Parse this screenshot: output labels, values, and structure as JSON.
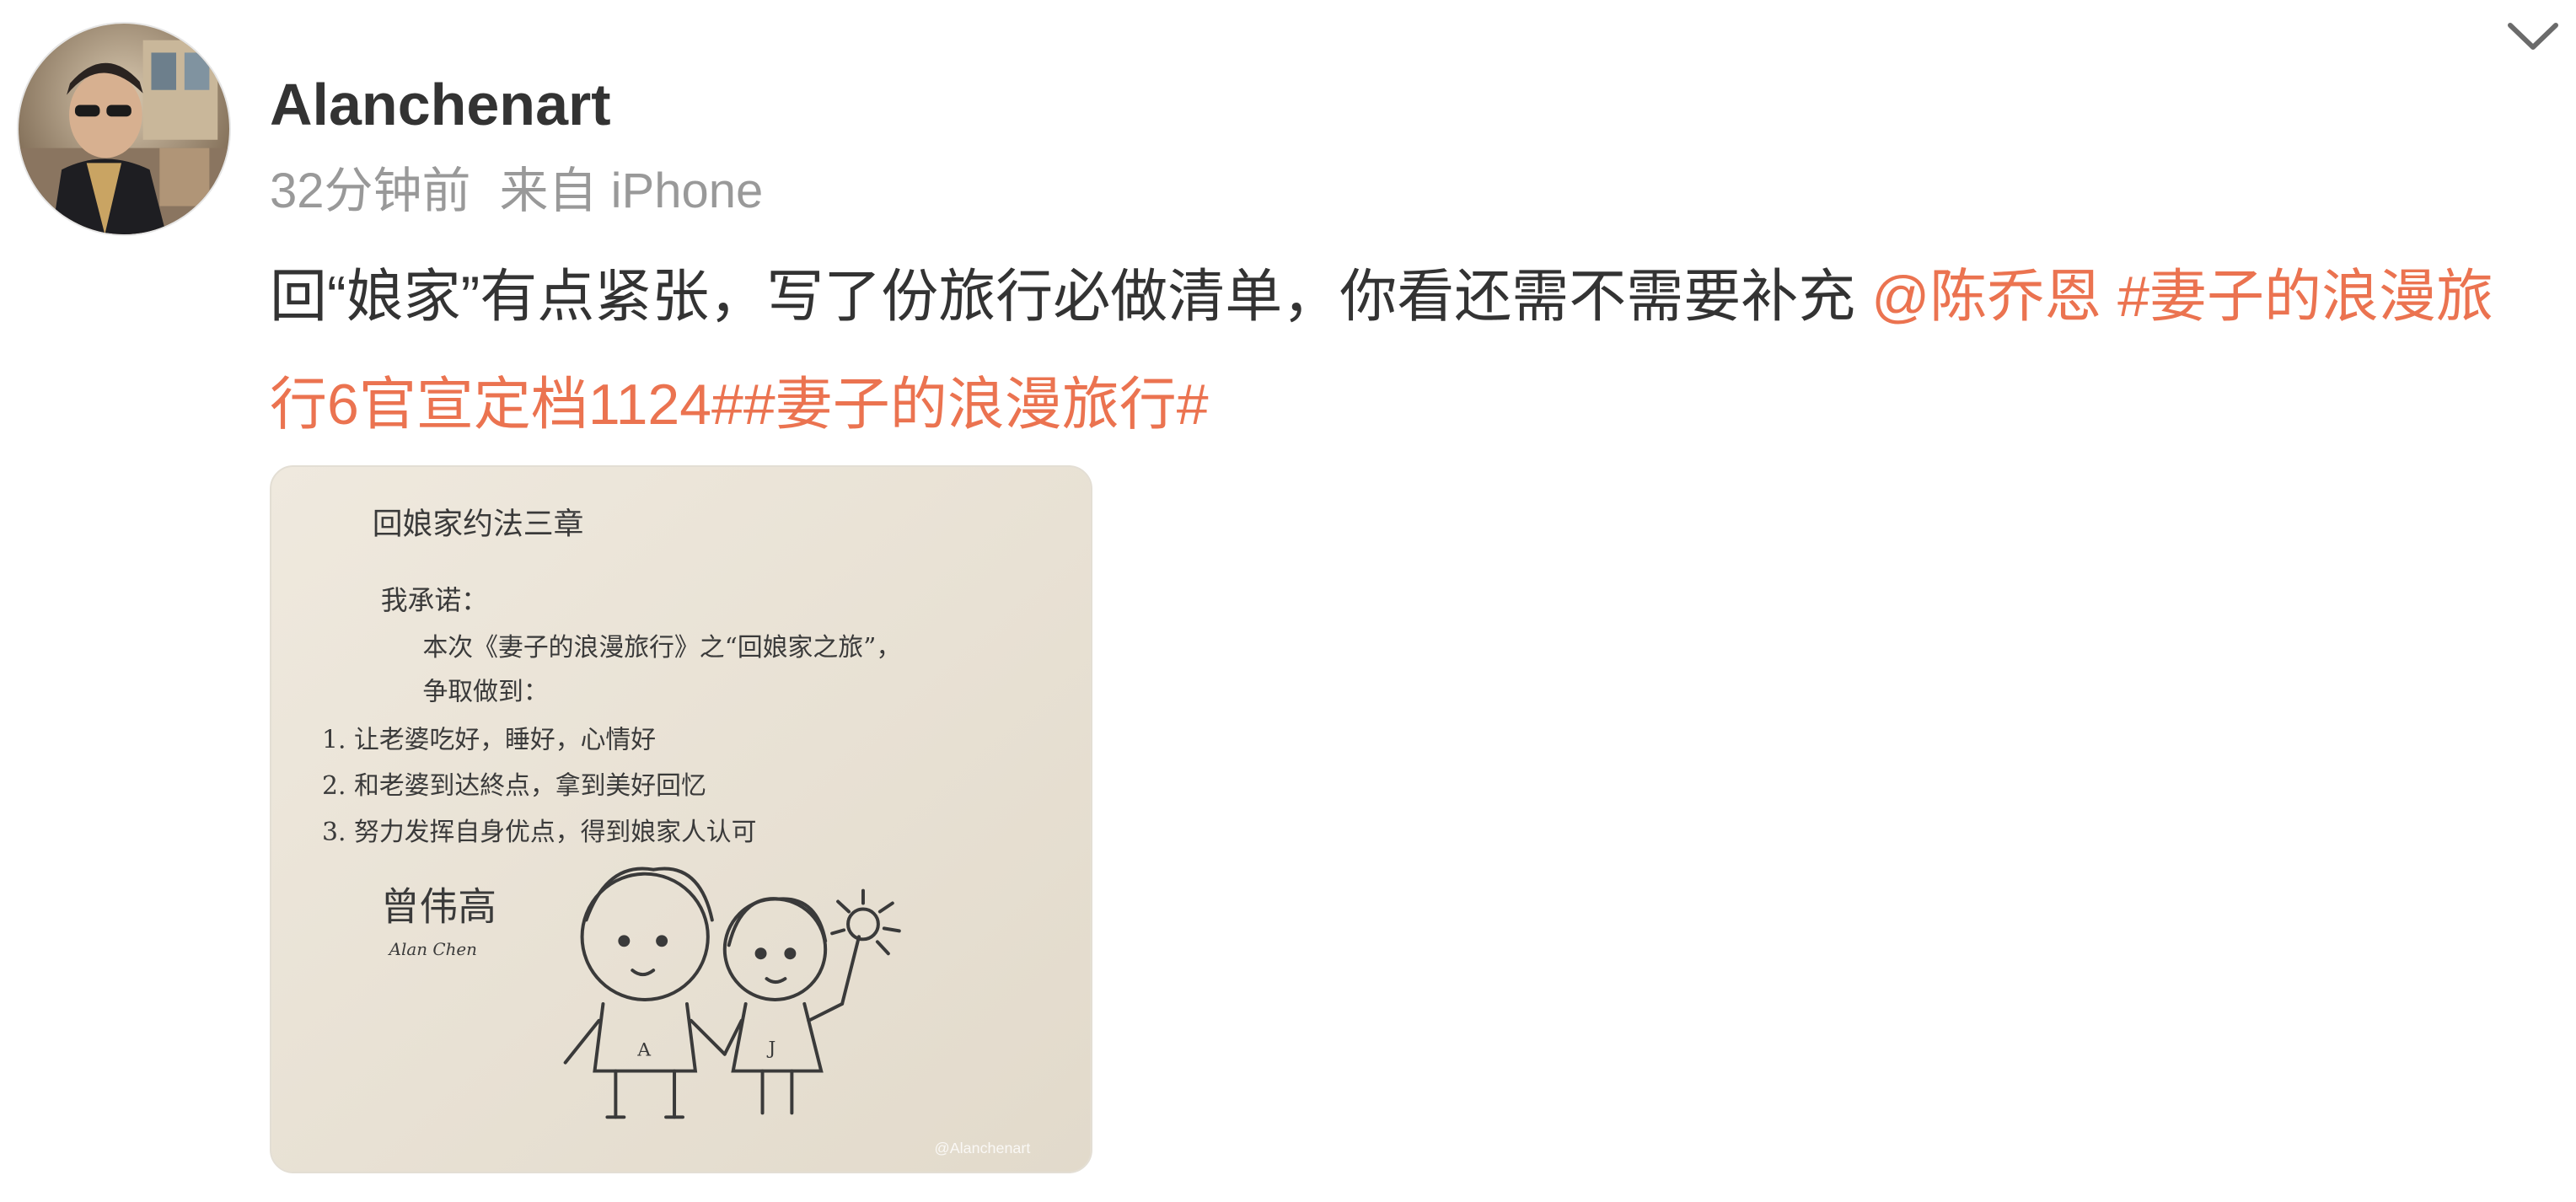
{
  "post": {
    "username": "Alanchenart",
    "time": "32分钟前",
    "source_label": "来自",
    "source_device": "iPhone",
    "text_plain": "回“娘家”有点紧张，写了份旅行必做清单，你看还需不需要补充 ",
    "mention": "@陈乔恩",
    "hashtag1": "#妻子的浪漫旅行6官宣定档1124#",
    "hashtag2": "#妻子的浪漫旅行#"
  },
  "photo": {
    "note_title": "回娘家约法三章",
    "note_intro": "我承诺：",
    "note_line1": "本次《妻子的浪漫旅行》之“回娘家之旅”，",
    "note_line2": "争取做到：",
    "note_item1": "1. 让老婆吃好，睡好，心情好",
    "note_item2": "2. 和老婆到达終点，拿到美好回忆",
    "note_item3": "3. 努力发挥自身优点，得到娘家人认可",
    "note_signature": "曾伟高",
    "note_signature_en": "Alan Chen",
    "figure_left_letter": "A",
    "figure_right_letter": "J",
    "watermark": "@Alanchenart"
  },
  "icons": {
    "expand": "chevron-down-icon",
    "avatar": "avatar"
  },
  "colors": {
    "link": "#eb7350",
    "username": "#333333",
    "meta": "#999999",
    "paper": "#ece6da"
  }
}
